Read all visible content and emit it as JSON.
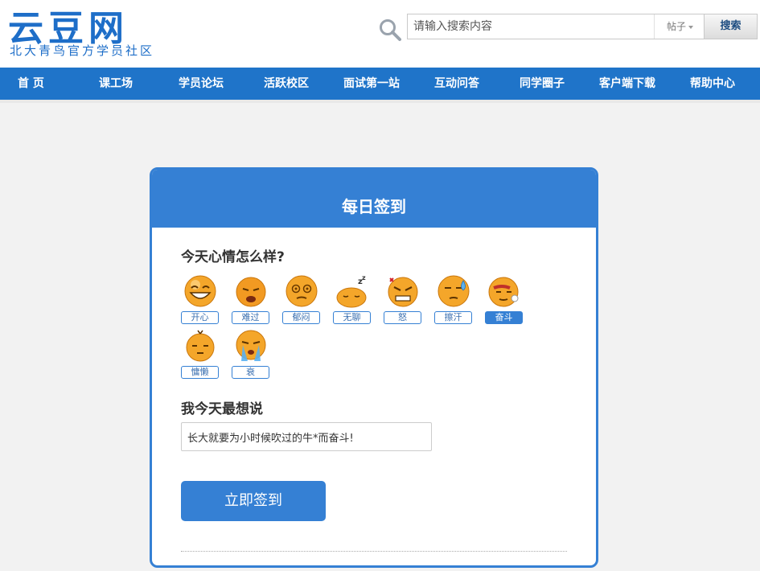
{
  "header": {
    "logo_text": "云豆网",
    "logo_subtitle": "北大青鸟官方学员社区",
    "search": {
      "placeholder": "请输入搜索内容",
      "type_selected": "帖子",
      "button_label": "搜索"
    }
  },
  "nav": {
    "items": [
      {
        "label": "首 页"
      },
      {
        "label": "课工场"
      },
      {
        "label": "学员论坛"
      },
      {
        "label": "活跃校区"
      },
      {
        "label": "面试第一站"
      },
      {
        "label": "互动问答"
      },
      {
        "label": "同学圈子"
      },
      {
        "label": "客户端下载"
      },
      {
        "label": "帮助中心"
      }
    ]
  },
  "checkin": {
    "title": "每日签到",
    "mood_question": "今天心情怎么样?",
    "moods": [
      {
        "label": "开心",
        "icon": "happy-face-icon"
      },
      {
        "label": "难过",
        "icon": "sad-face-icon"
      },
      {
        "label": "郁闷",
        "icon": "dizzy-face-icon"
      },
      {
        "label": "无聊",
        "icon": "sleepy-face-icon"
      },
      {
        "label": "怒",
        "icon": "angry-face-icon"
      },
      {
        "label": "擦汗",
        "icon": "sweat-face-icon"
      },
      {
        "label": "奋斗",
        "icon": "determined-face-icon",
        "selected": true
      },
      {
        "label": "慵懒",
        "icon": "lazy-face-icon"
      },
      {
        "label": "衰",
        "icon": "crying-face-icon"
      }
    ],
    "saying_question": "我今天最想说",
    "saying_value": "长大就要为小时候吹过的牛*而奋斗!",
    "submit_label": "立即签到"
  },
  "colors": {
    "nav_bg": "#1f74c9",
    "accent": "#3580d4",
    "page_bg": "#f2f2f2"
  }
}
